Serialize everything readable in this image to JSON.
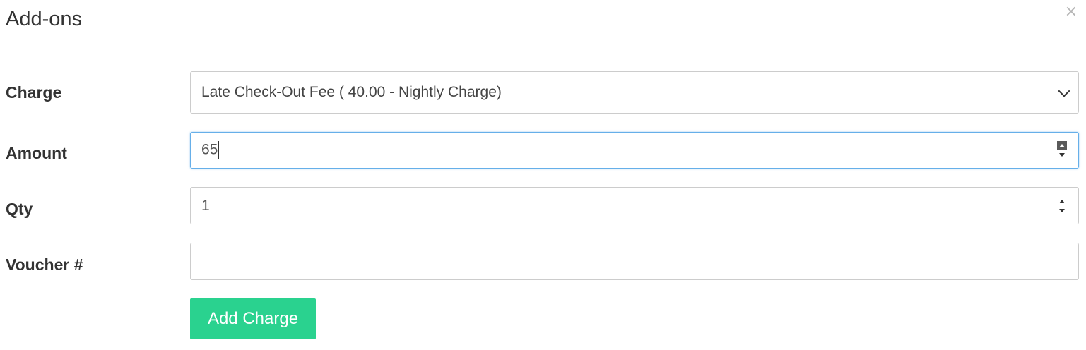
{
  "modal": {
    "title": "Add-ons",
    "close_glyph": "×"
  },
  "form": {
    "charge": {
      "label": "Charge",
      "selected": "Late Check-Out Fee ( 40.00 - Nightly Charge)"
    },
    "amount": {
      "label": "Amount",
      "value": "65"
    },
    "qty": {
      "label": "Qty",
      "value": "1"
    },
    "voucher": {
      "label": "Voucher #",
      "value": ""
    },
    "submit_label": "Add Charge"
  },
  "colors": {
    "accent": "#2ad28f",
    "focus_border": "#66afe9"
  },
  "icons": {
    "close": "close-icon",
    "select": "chevron-down-icon",
    "stepper_up": "caret-up-icon",
    "stepper_down": "caret-down-icon"
  }
}
